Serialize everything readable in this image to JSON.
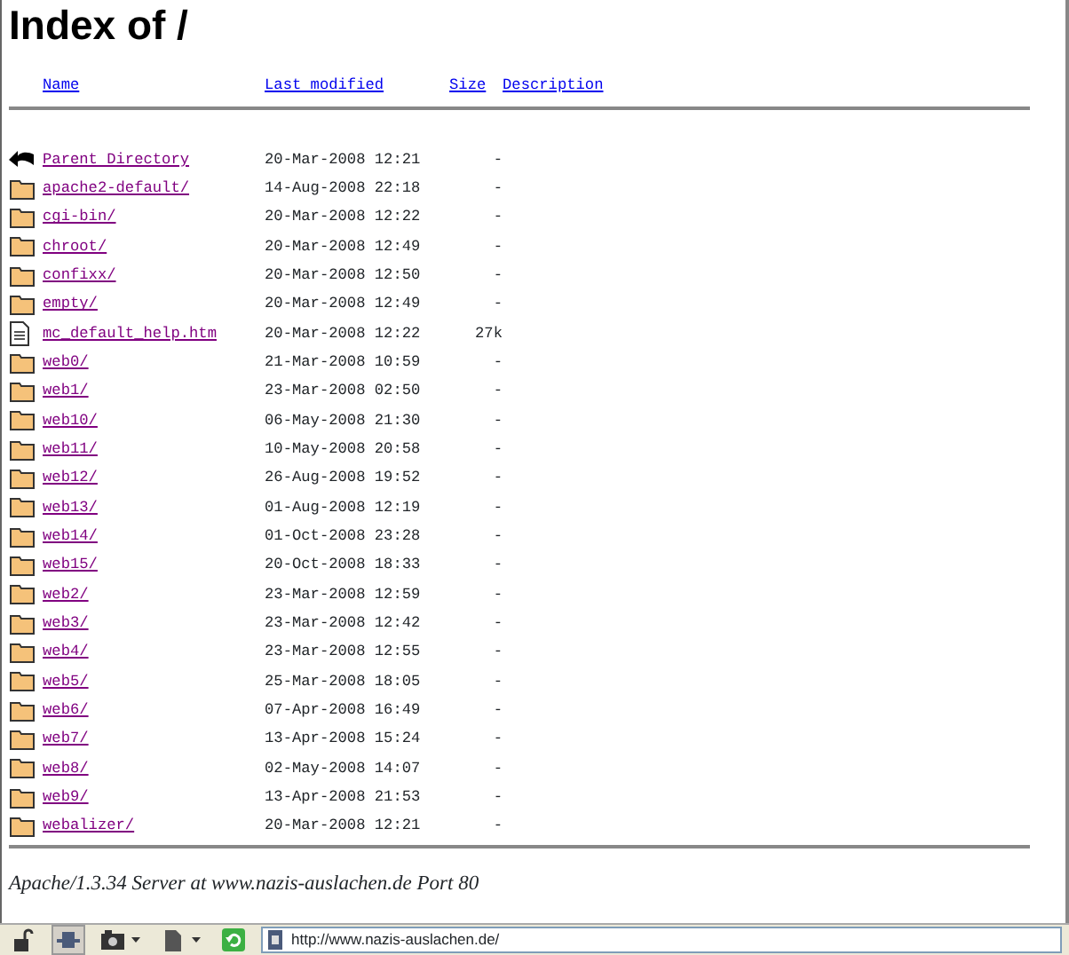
{
  "title": "Index of /",
  "columns": [
    {
      "label": "Name"
    },
    {
      "label": "Last modified"
    },
    {
      "label": "Size"
    },
    {
      "label": "Description"
    }
  ],
  "rows": [
    {
      "kind": "parent",
      "name": "Parent Directory",
      "modified": "20-Mar-2008 12:21",
      "size": "-"
    },
    {
      "kind": "folder",
      "name": "apache2-default/",
      "modified": "14-Aug-2008 22:18",
      "size": "-"
    },
    {
      "kind": "folder",
      "name": "cgi-bin/",
      "modified": "20-Mar-2008 12:22",
      "size": "-"
    },
    {
      "kind": "folder",
      "name": "chroot/",
      "modified": "20-Mar-2008 12:49",
      "size": "-"
    },
    {
      "kind": "folder",
      "name": "confixx/",
      "modified": "20-Mar-2008 12:50",
      "size": "-"
    },
    {
      "kind": "folder",
      "name": "empty/",
      "modified": "20-Mar-2008 12:49",
      "size": "-"
    },
    {
      "kind": "file",
      "name": "mc_default_help.htm",
      "modified": "20-Mar-2008 12:22",
      "size": "27k"
    },
    {
      "kind": "folder",
      "name": "web0/",
      "modified": "21-Mar-2008 10:59",
      "size": "-"
    },
    {
      "kind": "folder",
      "name": "web1/",
      "modified": "23-Mar-2008 02:50",
      "size": "-"
    },
    {
      "kind": "folder",
      "name": "web10/",
      "modified": "06-May-2008 21:30",
      "size": "-"
    },
    {
      "kind": "folder",
      "name": "web11/",
      "modified": "10-May-2008 20:58",
      "size": "-"
    },
    {
      "kind": "folder",
      "name": "web12/",
      "modified": "26-Aug-2008 19:52",
      "size": "-"
    },
    {
      "kind": "folder",
      "name": "web13/",
      "modified": "01-Aug-2008 12:19",
      "size": "-"
    },
    {
      "kind": "folder",
      "name": "web14/",
      "modified": "01-Oct-2008 23:28",
      "size": "-"
    },
    {
      "kind": "folder",
      "name": "web15/",
      "modified": "20-Oct-2008 18:33",
      "size": "-"
    },
    {
      "kind": "folder",
      "name": "web2/",
      "modified": "23-Mar-2008 12:59",
      "size": "-"
    },
    {
      "kind": "folder",
      "name": "web3/",
      "modified": "23-Mar-2008 12:42",
      "size": "-"
    },
    {
      "kind": "folder",
      "name": "web4/",
      "modified": "23-Mar-2008 12:55",
      "size": "-"
    },
    {
      "kind": "folder",
      "name": "web5/",
      "modified": "25-Mar-2008 18:05",
      "size": "-"
    },
    {
      "kind": "folder",
      "name": "web6/",
      "modified": "07-Apr-2008 16:49",
      "size": "-"
    },
    {
      "kind": "folder",
      "name": "web7/",
      "modified": "13-Apr-2008 15:24",
      "size": "-"
    },
    {
      "kind": "folder",
      "name": "web8/",
      "modified": "02-May-2008 14:07",
      "size": "-"
    },
    {
      "kind": "folder",
      "name": "web9/",
      "modified": "13-Apr-2008 21:53",
      "size": "-"
    },
    {
      "kind": "folder",
      "name": "webalizer/",
      "modified": "20-Mar-2008 12:21",
      "size": "-"
    }
  ],
  "footer": "Apache/1.3.34 Server at www.nazis-auslachen.de Port 80",
  "status_bar": {
    "tools": [
      {
        "kind": "lock",
        "selected": false,
        "dropdown": false
      },
      {
        "kind": "network",
        "selected": true,
        "dropdown": false
      },
      {
        "kind": "camera",
        "selected": false,
        "dropdown": true
      },
      {
        "kind": "page",
        "selected": false,
        "dropdown": true
      },
      {
        "kind": "refresh",
        "selected": false,
        "dropdown": false
      }
    ],
    "url": "http://www.nazis-auslachen.de/"
  }
}
